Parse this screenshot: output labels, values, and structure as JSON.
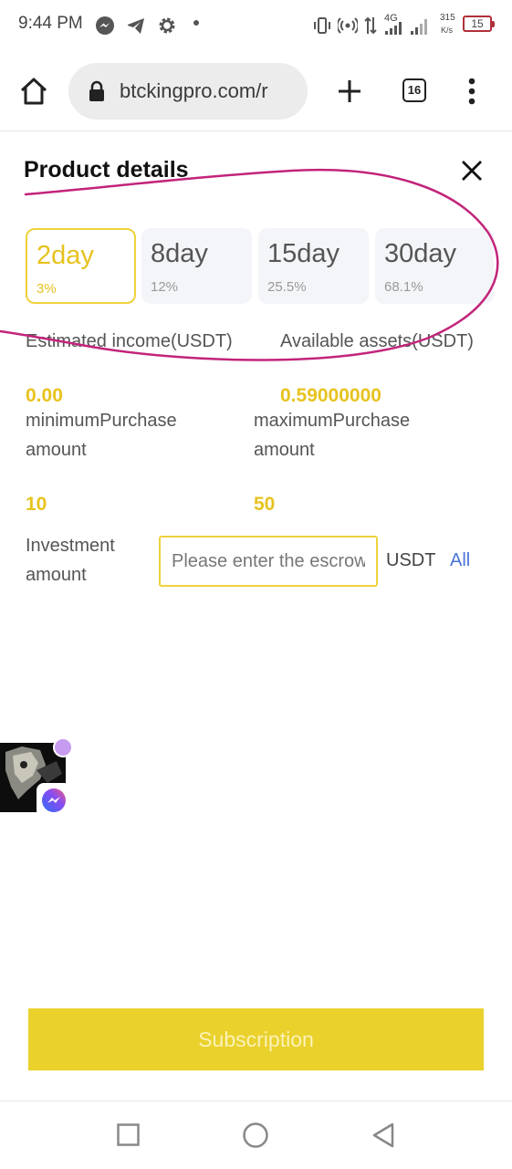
{
  "status": {
    "time": "9:44 PM",
    "net_type": "4G",
    "speed_value": "315",
    "speed_unit": "K/s",
    "battery": "15"
  },
  "browser": {
    "url": "btckingpro.com/r",
    "tab_count": "16"
  },
  "page": {
    "title": "Product details",
    "tabs": [
      {
        "label": "2day",
        "rate": "3%"
      },
      {
        "label": "8day",
        "rate": "12%"
      },
      {
        "label": "15day",
        "rate": "25.5%"
      },
      {
        "label": "30day",
        "rate": "68.1%"
      }
    ],
    "estimated_income_label": "Estimated income(USDT)",
    "available_assets_label": "Available assets(USDT)",
    "estimated_income_value": "0.00",
    "available_assets_value": "0.59000000",
    "min_purchase_label_1": "minimumPurchase",
    "min_purchase_label_2": "amount",
    "max_purchase_label_1": "maximumPurchase",
    "max_purchase_label_2": "amount",
    "min_purchase_value": "10",
    "max_purchase_value": "50",
    "investment_label_1": "Investment",
    "investment_label_2": "amount",
    "investment_placeholder": "Please enter the escrow amount",
    "investment_unit": "USDT",
    "all_label": "All",
    "subscribe_label": "Subscription"
  },
  "colors": {
    "accent_yellow": "#e7c31f",
    "button_yellow": "#ead12c",
    "link_blue": "#4a74d8",
    "annotation_pink": "#c2247a"
  }
}
